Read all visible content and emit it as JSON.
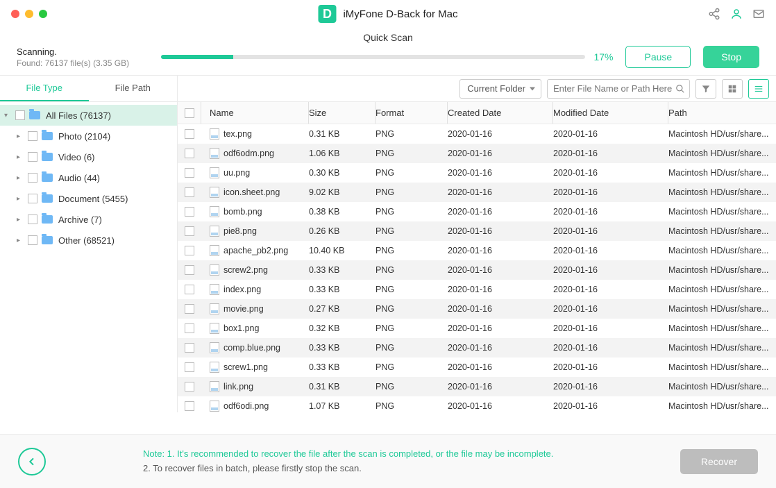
{
  "app": {
    "title": "iMyFone D-Back for Mac",
    "logo_letter": "D"
  },
  "scan": {
    "mode": "Quick Scan",
    "status": "Scanning.",
    "found": "Found: 76137 file(s) (3.35 GB)",
    "percent": "17%",
    "pause": "Pause",
    "stop": "Stop"
  },
  "tabs": {
    "file_type": "File Type",
    "file_path": "File Path"
  },
  "tree": {
    "root": "All Files (76137)",
    "children": [
      {
        "label": "Photo (2104)"
      },
      {
        "label": "Video (6)"
      },
      {
        "label": "Audio (44)"
      },
      {
        "label": "Document (5455)"
      },
      {
        "label": "Archive (7)"
      },
      {
        "label": "Other (68521)"
      }
    ]
  },
  "toolbar": {
    "scope": "Current Folder",
    "search_placeholder": "Enter File Name or Path Here"
  },
  "columns": {
    "name": "Name",
    "size": "Size",
    "format": "Format",
    "created": "Created Date",
    "modified": "Modified Date",
    "path": "Path"
  },
  "rows": [
    {
      "name": "tex.png",
      "size": "0.31 KB",
      "format": "PNG",
      "created": "2020-01-16",
      "modified": "2020-01-16",
      "path": "Macintosh HD/usr/share..."
    },
    {
      "name": "odf6odm.png",
      "size": "1.06 KB",
      "format": "PNG",
      "created": "2020-01-16",
      "modified": "2020-01-16",
      "path": "Macintosh HD/usr/share..."
    },
    {
      "name": "uu.png",
      "size": "0.30 KB",
      "format": "PNG",
      "created": "2020-01-16",
      "modified": "2020-01-16",
      "path": "Macintosh HD/usr/share..."
    },
    {
      "name": "icon.sheet.png",
      "size": "9.02 KB",
      "format": "PNG",
      "created": "2020-01-16",
      "modified": "2020-01-16",
      "path": "Macintosh HD/usr/share..."
    },
    {
      "name": "bomb.png",
      "size": "0.38 KB",
      "format": "PNG",
      "created": "2020-01-16",
      "modified": "2020-01-16",
      "path": "Macintosh HD/usr/share..."
    },
    {
      "name": "pie8.png",
      "size": "0.26 KB",
      "format": "PNG",
      "created": "2020-01-16",
      "modified": "2020-01-16",
      "path": "Macintosh HD/usr/share..."
    },
    {
      "name": "apache_pb2.png",
      "size": "10.40 KB",
      "format": "PNG",
      "created": "2020-01-16",
      "modified": "2020-01-16",
      "path": "Macintosh HD/usr/share..."
    },
    {
      "name": "screw2.png",
      "size": "0.33 KB",
      "format": "PNG",
      "created": "2020-01-16",
      "modified": "2020-01-16",
      "path": "Macintosh HD/usr/share..."
    },
    {
      "name": "index.png",
      "size": "0.33 KB",
      "format": "PNG",
      "created": "2020-01-16",
      "modified": "2020-01-16",
      "path": "Macintosh HD/usr/share..."
    },
    {
      "name": "movie.png",
      "size": "0.27 KB",
      "format": "PNG",
      "created": "2020-01-16",
      "modified": "2020-01-16",
      "path": "Macintosh HD/usr/share..."
    },
    {
      "name": "box1.png",
      "size": "0.32 KB",
      "format": "PNG",
      "created": "2020-01-16",
      "modified": "2020-01-16",
      "path": "Macintosh HD/usr/share..."
    },
    {
      "name": "comp.blue.png",
      "size": "0.33 KB",
      "format": "PNG",
      "created": "2020-01-16",
      "modified": "2020-01-16",
      "path": "Macintosh HD/usr/share..."
    },
    {
      "name": "screw1.png",
      "size": "0.33 KB",
      "format": "PNG",
      "created": "2020-01-16",
      "modified": "2020-01-16",
      "path": "Macintosh HD/usr/share..."
    },
    {
      "name": "link.png",
      "size": "0.31 KB",
      "format": "PNG",
      "created": "2020-01-16",
      "modified": "2020-01-16",
      "path": "Macintosh HD/usr/share..."
    },
    {
      "name": "odf6odi.png",
      "size": "1.07 KB",
      "format": "PNG",
      "created": "2020-01-16",
      "modified": "2020-01-16",
      "path": "Macintosh HD/usr/share..."
    }
  ],
  "footer": {
    "note1": "Note: 1. It's recommended to recover the file after the scan is completed, or the file may be incomplete.",
    "note2": "2. To recover files in batch, please firstly stop the scan.",
    "recover": "Recover"
  }
}
